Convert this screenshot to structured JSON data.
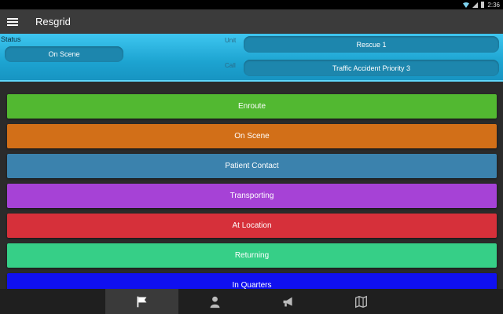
{
  "statusbar": {
    "time": "2:36"
  },
  "app": {
    "title": "Resgrid"
  },
  "header": {
    "status_label": "Status",
    "status_value": "On Scene",
    "unit_label": "Unit",
    "unit_value": "Rescue 1",
    "call_label": "Call",
    "call_value": "Traffic Accident Priority 3"
  },
  "status_buttons": [
    {
      "label": "Enroute",
      "color": "#52b831"
    },
    {
      "label": "On Scene",
      "color": "#d26f18"
    },
    {
      "label": "Patient Contact",
      "color": "#3b82ad"
    },
    {
      "label": "Transporting",
      "color": "#a642d6"
    },
    {
      "label": "At Location",
      "color": "#d6303a"
    },
    {
      "label": "Returning",
      "color": "#36cf87"
    },
    {
      "label": "In Quarters",
      "color": "#1010f0"
    }
  ],
  "bottom_nav": [
    {
      "icon": "flag-icon",
      "active": true
    },
    {
      "icon": "person-icon",
      "active": false
    },
    {
      "icon": "megaphone-icon",
      "active": false
    },
    {
      "icon": "map-icon",
      "active": false
    }
  ]
}
